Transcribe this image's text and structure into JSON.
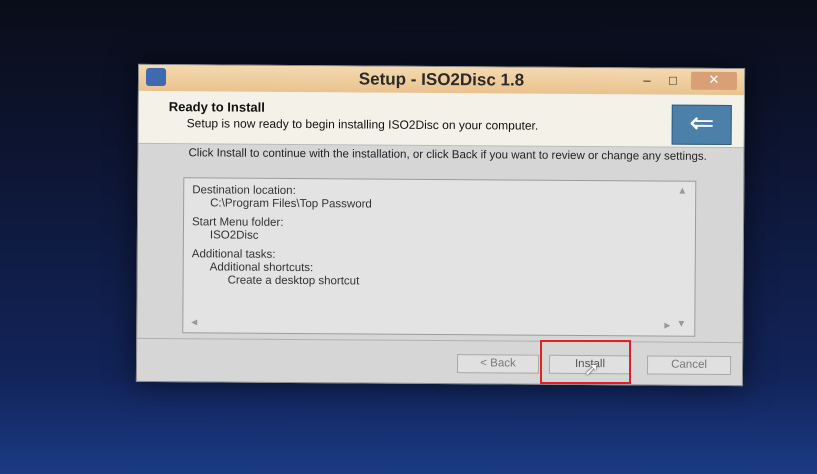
{
  "window": {
    "title": "Setup - ISO2Disc 1.8",
    "controls": {
      "minimize": "–",
      "maximize": "□",
      "close": "✕"
    }
  },
  "header": {
    "title": "Ready to Install",
    "subtitle": "Setup is now ready to begin installing ISO2Disc on your computer.",
    "icon": "install-arrow-icon"
  },
  "instruction": "Click Install to continue with the installation, or click Back if you want to review or change any settings.",
  "summary": {
    "destination_label": "Destination location:",
    "destination_value": "C:\\Program Files\\Top Password",
    "start_menu_label": "Start Menu folder:",
    "start_menu_value": "ISO2Disc",
    "tasks_label": "Additional tasks:",
    "shortcuts_label": "Additional shortcuts:",
    "shortcut_item": "Create a desktop shortcut"
  },
  "buttons": {
    "back": "< Back",
    "install": "Install",
    "cancel": "Cancel"
  },
  "colors": {
    "highlight": "#e2201f",
    "titlebar": "#f4d9b0"
  }
}
